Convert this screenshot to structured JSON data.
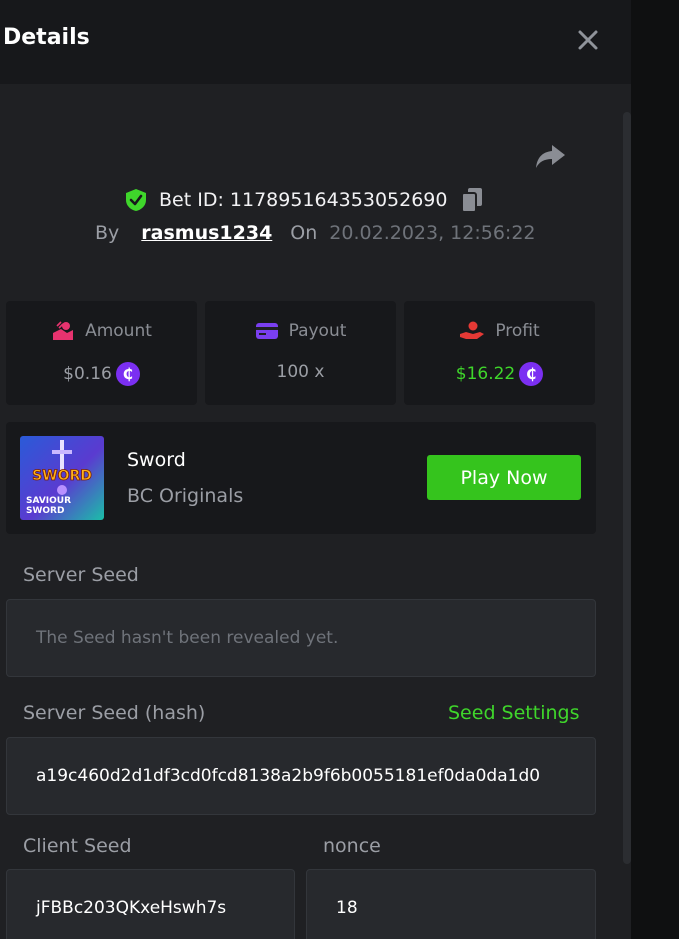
{
  "header": {
    "title": "Details"
  },
  "bet": {
    "id_text": "Bet ID: 117895164353052690",
    "by_label": "By",
    "username": "rasmus1234",
    "on_label": "On",
    "date": "20.02.2023, 12:56:22"
  },
  "stats": {
    "amount_label": "Amount",
    "amount_value": "$0.16",
    "payout_label": "Payout",
    "payout_value": "100 x",
    "profit_label": "Profit",
    "profit_value": "$16.22",
    "coin_symbol": "₵"
  },
  "game": {
    "name": "Sword",
    "provider": "BC Originals",
    "play_label": "Play Now",
    "thumb_line1": "SWORD",
    "thumb_line2": "SAVIOUR",
    "thumb_line3": "SWORD"
  },
  "seeds": {
    "server_seed_label": "Server Seed",
    "server_seed_value": "The Seed hasn't been revealed yet.",
    "server_hash_label": "Server Seed (hash)",
    "seed_settings_label": "Seed Settings",
    "server_hash_value": "a19c460d2d1df3cd0fcd8138a2b9f6b0055181ef0da0da1d0",
    "client_seed_label": "Client Seed",
    "client_seed_value": "jFBBc203QKxeHswh7s",
    "nonce_label": "nonce",
    "nonce_value": "18"
  },
  "colors": {
    "accent_green": "#35c41d",
    "profit_green": "#3fd62b",
    "coin_purple": "#7b2ff2",
    "amount_pink": "#e8336f",
    "payout_purple": "#7a3ff0",
    "profit_red": "#e53935"
  },
  "icons": {
    "close": "close-icon",
    "share": "share-icon",
    "verified": "shield-check-icon",
    "copy": "copy-icon",
    "amount": "bet-amount-icon",
    "payout": "payout-card-icon",
    "profit": "profit-hand-icon",
    "coin": "coin-icon"
  }
}
